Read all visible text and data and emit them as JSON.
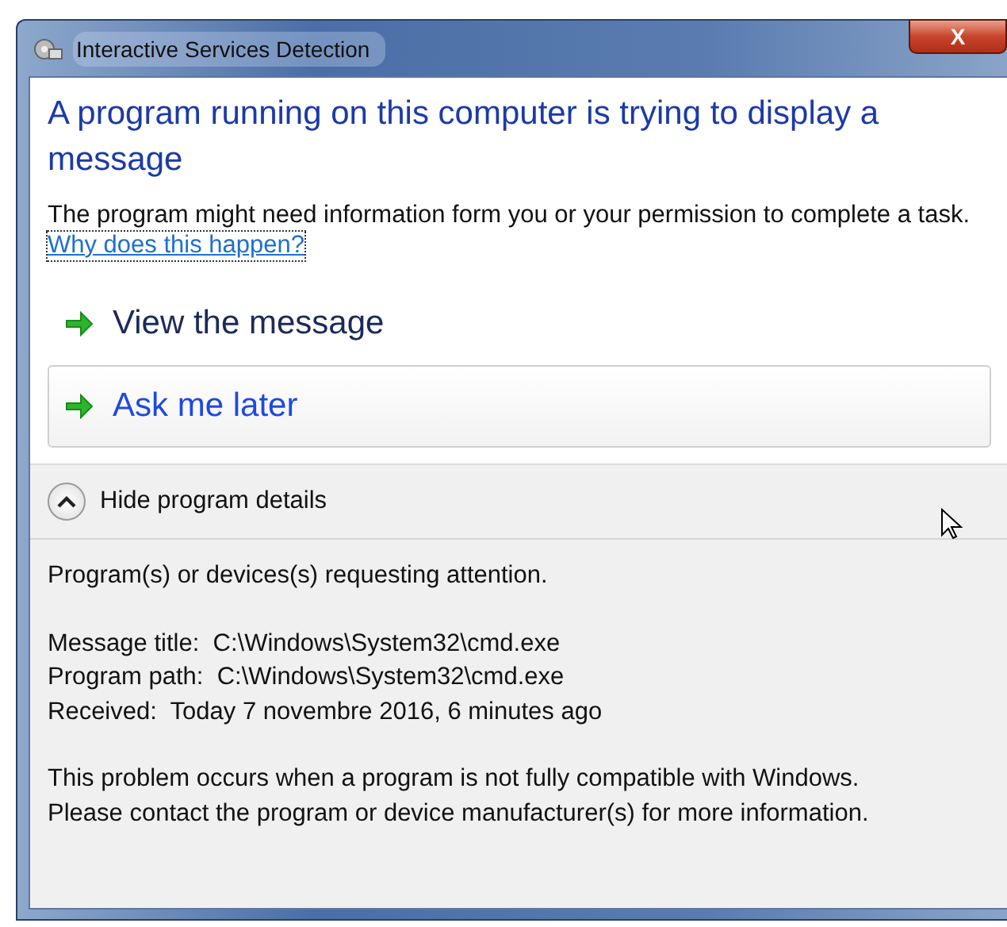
{
  "window": {
    "title": "Interactive Services Detection",
    "close_label": "X"
  },
  "heading": "A program running on this computer is trying to display a message",
  "description": "The program might need information form you or your permission to complete a task.",
  "help_link": "Why does this happen?",
  "options": [
    {
      "label": "View the message",
      "selected": false
    },
    {
      "label": "Ask me later",
      "selected": true
    }
  ],
  "details_toggle": {
    "label": "Hide program details",
    "expanded": true
  },
  "details": {
    "intro": "Program(s) or devices(s) requesting attention.",
    "fields": [
      {
        "label": "Message title:",
        "value": "C:\\Windows\\System32\\cmd.exe"
      },
      {
        "label": "Program path:",
        "value": "C:\\Windows\\System32\\cmd.exe"
      },
      {
        "label": "Received:",
        "value": "Today 7 novembre 2016, 6 minutes ago"
      }
    ],
    "note": [
      "This problem occurs when a program is not fully compatible with Windows.",
      "Please contact the program or device manufacturer(s) for more information."
    ]
  }
}
